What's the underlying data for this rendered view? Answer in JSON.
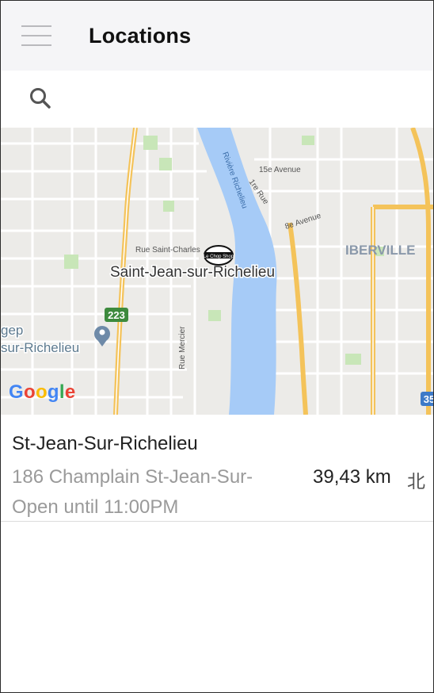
{
  "header": {
    "title": "Locations",
    "menu_icon": "hamburger-menu-icon"
  },
  "search": {
    "placeholder": "",
    "icon": "search-icon"
  },
  "map": {
    "city_label": "Saint-Jean-sur-Richelieu",
    "district_label": "IBERVILLE",
    "river_label": "Rivière Richelieu",
    "streets": [
      "15e Avenue",
      "1re Rue",
      "8e Avenue",
      "Rue Saint-Charles",
      "Rue Mercier"
    ],
    "route_223": "223",
    "route_35": "35",
    "poi_label_line1": "gep",
    "poi_label_line2": "sur-Richelieu",
    "store_logo_text": "Le Chop Shop",
    "attribution": {
      "g1": "G",
      "o1": "o",
      "o2": "o",
      "g2": "g",
      "l": "l",
      "e": "e"
    }
  },
  "locations": [
    {
      "name": "St-Jean-Sur-Richelieu",
      "address": "186 Champlain St-Jean-Sur-",
      "hours": "Open until 11:00PM",
      "distance": "39,43 km",
      "direction": "北"
    }
  ],
  "colors": {
    "header_bg": "#f5f5f7",
    "map_bg": "#e9e8e6",
    "water": "#a6cbf7",
    "highway": "#f7c960",
    "park": "#c6e7b5"
  }
}
